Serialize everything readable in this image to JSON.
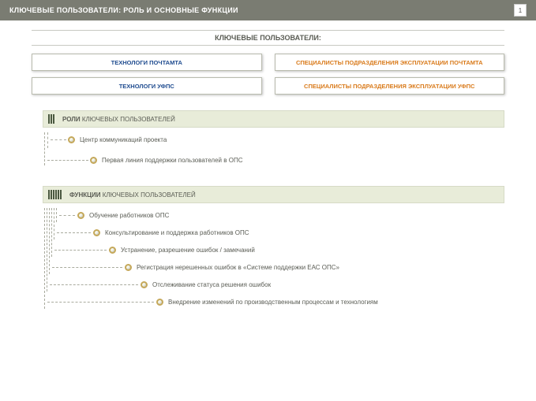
{
  "header": {
    "title": "КЛЮЧЕВЫЕ ПОЛЬЗОВАТЕЛИ: РОЛЬ И ОСНОВНЫЕ ФУНКЦИИ",
    "page": "1"
  },
  "subtitle": "КЛЮЧЕВЫЕ ПОЛЬЗОВАТЕЛИ:",
  "boxes": {
    "tl": "ТЕХНОЛОГИ ПОЧТАМТА",
    "tr": "СПЕЦИАЛИСТЫ ПОДРАЗДЕЛЕНИЯ ЭКСПЛУАТАЦИИ ПОЧТАМТА",
    "bl": "ТЕХНОЛОГИ УФПС",
    "br": "СПЕЦИАЛИСТЫ ПОДРАЗДЕЛЕНИЯ ЭКСПЛУАТАЦИИ УФПС"
  },
  "roles": {
    "title_bold": "РОЛИ",
    "title_rest": " КЛЮЧЕВЫХ ПОЛЬЗОВАТЕЛЕЙ",
    "items": [
      "Центр коммуникаций проекта",
      "Первая линия поддержки пользователей в ОПС"
    ]
  },
  "functions": {
    "title_bold": "ФУНКЦИИ",
    "title_rest": " КЛЮЧЕВЫХ ПОЛЬЗОВАТЕЛЕЙ",
    "items": [
      "Обучение работников ОПС",
      "Консультирование и поддержка работников ОПС",
      "Устранение, разрешение ошибок / замечаний",
      "Регистрация нерешенных ошибок в «Системе поддержки ЕАС ОПС»",
      "Отслеживание статуса решения ошибок",
      "Внедрение изменений по производственным процессам и технологиям"
    ]
  }
}
